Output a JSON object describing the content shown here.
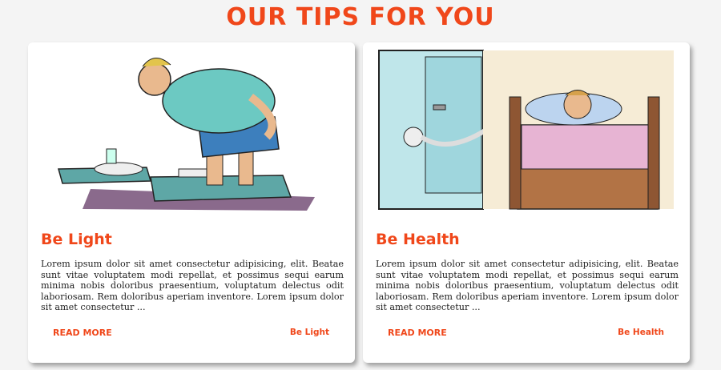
{
  "page": {
    "title": "OUR TIPS FOR YOU"
  },
  "cards": [
    {
      "title": "Be Light",
      "text": "Lorem ipsum dolor sit amet consectetur adipisicing, elit. Beatae sunt vitae voluptatem modi repellat, et possimus sequi earum minima nobis doloribus praesentium, voluptatum delectus odit laboriosam. Rem doloribus aperiam inventore. Lorem ipsum dolor sit amet consectetur ...",
      "read_more": "READ MORE",
      "tag": "Be Light",
      "image": "man-on-scale-illustration"
    },
    {
      "title": "Be Health",
      "text": "Lorem ipsum dolor sit amet consectetur adipisicing, elit. Beatae sunt vitae voluptatem modi repellat, et possimus sequi earum minima nobis doloribus praesentium, voluptatum delectus odit laboriosam. Rem doloribus aperiam inventore. Lorem ipsum dolor sit amet consectetur ...",
      "read_more": "READ MORE",
      "tag": "Be Health",
      "image": "man-sick-in-bed-illustration"
    }
  ],
  "colors": {
    "accent": "#f0471a",
    "background": "#f4f4f4",
    "card": "#ffffff"
  }
}
